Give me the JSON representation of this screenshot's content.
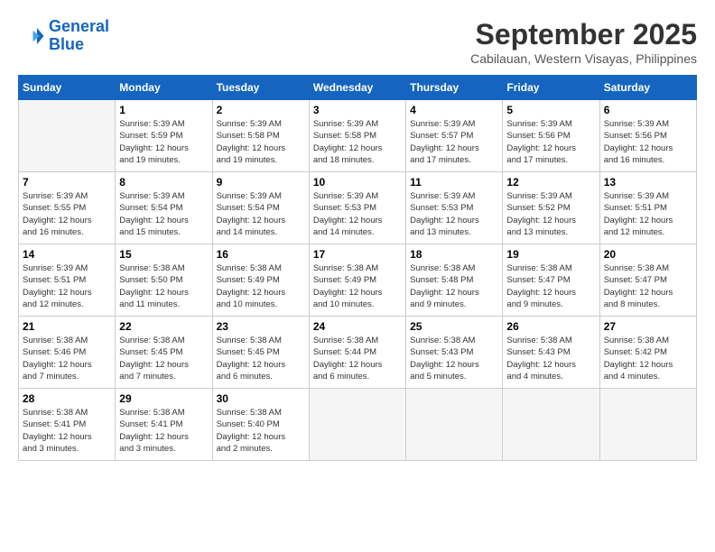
{
  "logo": {
    "line1": "General",
    "line2": "Blue"
  },
  "title": "September 2025",
  "location": "Cabilauan, Western Visayas, Philippines",
  "weekdays": [
    "Sunday",
    "Monday",
    "Tuesday",
    "Wednesday",
    "Thursday",
    "Friday",
    "Saturday"
  ],
  "weeks": [
    [
      {
        "day": "",
        "info": ""
      },
      {
        "day": "1",
        "info": "Sunrise: 5:39 AM\nSunset: 5:59 PM\nDaylight: 12 hours\nand 19 minutes."
      },
      {
        "day": "2",
        "info": "Sunrise: 5:39 AM\nSunset: 5:58 PM\nDaylight: 12 hours\nand 19 minutes."
      },
      {
        "day": "3",
        "info": "Sunrise: 5:39 AM\nSunset: 5:58 PM\nDaylight: 12 hours\nand 18 minutes."
      },
      {
        "day": "4",
        "info": "Sunrise: 5:39 AM\nSunset: 5:57 PM\nDaylight: 12 hours\nand 17 minutes."
      },
      {
        "day": "5",
        "info": "Sunrise: 5:39 AM\nSunset: 5:56 PM\nDaylight: 12 hours\nand 17 minutes."
      },
      {
        "day": "6",
        "info": "Sunrise: 5:39 AM\nSunset: 5:56 PM\nDaylight: 12 hours\nand 16 minutes."
      }
    ],
    [
      {
        "day": "7",
        "info": "Sunrise: 5:39 AM\nSunset: 5:55 PM\nDaylight: 12 hours\nand 16 minutes."
      },
      {
        "day": "8",
        "info": "Sunrise: 5:39 AM\nSunset: 5:54 PM\nDaylight: 12 hours\nand 15 minutes."
      },
      {
        "day": "9",
        "info": "Sunrise: 5:39 AM\nSunset: 5:54 PM\nDaylight: 12 hours\nand 14 minutes."
      },
      {
        "day": "10",
        "info": "Sunrise: 5:39 AM\nSunset: 5:53 PM\nDaylight: 12 hours\nand 14 minutes."
      },
      {
        "day": "11",
        "info": "Sunrise: 5:39 AM\nSunset: 5:53 PM\nDaylight: 12 hours\nand 13 minutes."
      },
      {
        "day": "12",
        "info": "Sunrise: 5:39 AM\nSunset: 5:52 PM\nDaylight: 12 hours\nand 13 minutes."
      },
      {
        "day": "13",
        "info": "Sunrise: 5:39 AM\nSunset: 5:51 PM\nDaylight: 12 hours\nand 12 minutes."
      }
    ],
    [
      {
        "day": "14",
        "info": "Sunrise: 5:39 AM\nSunset: 5:51 PM\nDaylight: 12 hours\nand 12 minutes."
      },
      {
        "day": "15",
        "info": "Sunrise: 5:38 AM\nSunset: 5:50 PM\nDaylight: 12 hours\nand 11 minutes."
      },
      {
        "day": "16",
        "info": "Sunrise: 5:38 AM\nSunset: 5:49 PM\nDaylight: 12 hours\nand 10 minutes."
      },
      {
        "day": "17",
        "info": "Sunrise: 5:38 AM\nSunset: 5:49 PM\nDaylight: 12 hours\nand 10 minutes."
      },
      {
        "day": "18",
        "info": "Sunrise: 5:38 AM\nSunset: 5:48 PM\nDaylight: 12 hours\nand 9 minutes."
      },
      {
        "day": "19",
        "info": "Sunrise: 5:38 AM\nSunset: 5:47 PM\nDaylight: 12 hours\nand 9 minutes."
      },
      {
        "day": "20",
        "info": "Sunrise: 5:38 AM\nSunset: 5:47 PM\nDaylight: 12 hours\nand 8 minutes."
      }
    ],
    [
      {
        "day": "21",
        "info": "Sunrise: 5:38 AM\nSunset: 5:46 PM\nDaylight: 12 hours\nand 7 minutes."
      },
      {
        "day": "22",
        "info": "Sunrise: 5:38 AM\nSunset: 5:45 PM\nDaylight: 12 hours\nand 7 minutes."
      },
      {
        "day": "23",
        "info": "Sunrise: 5:38 AM\nSunset: 5:45 PM\nDaylight: 12 hours\nand 6 minutes."
      },
      {
        "day": "24",
        "info": "Sunrise: 5:38 AM\nSunset: 5:44 PM\nDaylight: 12 hours\nand 6 minutes."
      },
      {
        "day": "25",
        "info": "Sunrise: 5:38 AM\nSunset: 5:43 PM\nDaylight: 12 hours\nand 5 minutes."
      },
      {
        "day": "26",
        "info": "Sunrise: 5:38 AM\nSunset: 5:43 PM\nDaylight: 12 hours\nand 4 minutes."
      },
      {
        "day": "27",
        "info": "Sunrise: 5:38 AM\nSunset: 5:42 PM\nDaylight: 12 hours\nand 4 minutes."
      }
    ],
    [
      {
        "day": "28",
        "info": "Sunrise: 5:38 AM\nSunset: 5:41 PM\nDaylight: 12 hours\nand 3 minutes."
      },
      {
        "day": "29",
        "info": "Sunrise: 5:38 AM\nSunset: 5:41 PM\nDaylight: 12 hours\nand 3 minutes."
      },
      {
        "day": "30",
        "info": "Sunrise: 5:38 AM\nSunset: 5:40 PM\nDaylight: 12 hours\nand 2 minutes."
      },
      {
        "day": "",
        "info": ""
      },
      {
        "day": "",
        "info": ""
      },
      {
        "day": "",
        "info": ""
      },
      {
        "day": "",
        "info": ""
      }
    ]
  ]
}
